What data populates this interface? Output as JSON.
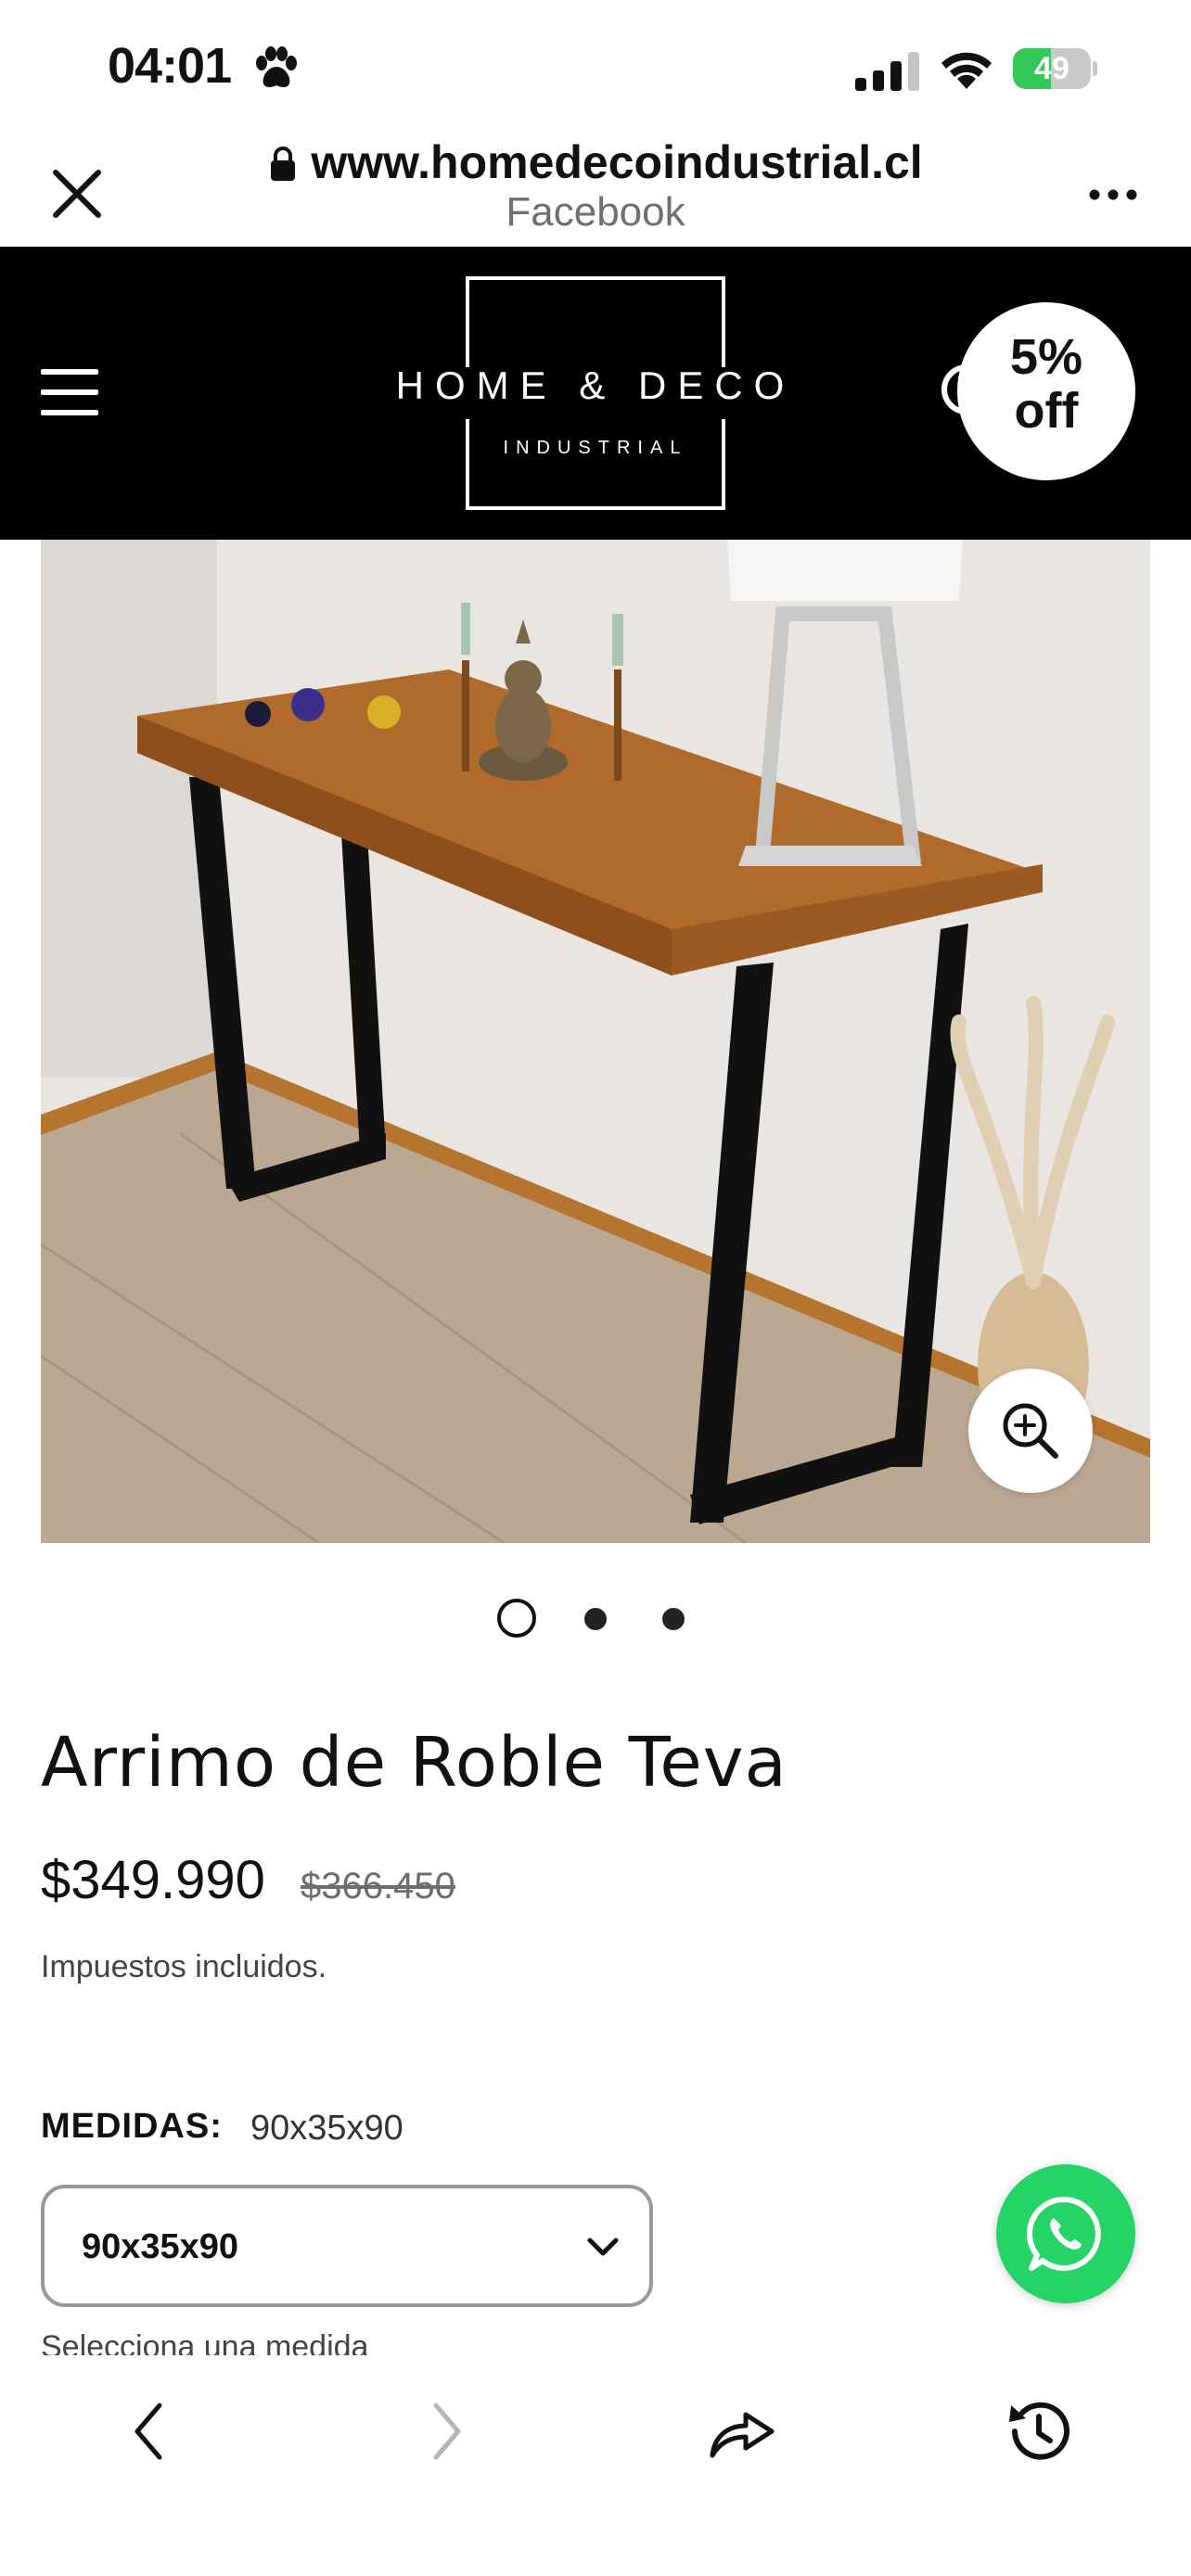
{
  "status_bar": {
    "time": "04:01",
    "battery_level": "49",
    "battery_fraction": 0.49
  },
  "browser": {
    "url": "www.homedecoindustrial.cl",
    "source": "Facebook"
  },
  "site_header": {
    "logo_main": "HOME & DECO",
    "logo_sub": "INDUSTRIAL",
    "badge_line1": "5%",
    "badge_line2": "off"
  },
  "carousel": {
    "total": 3,
    "active_index": 0
  },
  "product": {
    "title": "Arrimo de Roble Teva",
    "price": "$349.990",
    "compare_price": "$366.450",
    "tax_note": "Impuestos incluidos.",
    "variant_label": "MEDIDAS:",
    "variant_value": "90x35x90",
    "select_value": "90x35x90",
    "helper_text": "Selecciona una medida"
  },
  "colors": {
    "header_bg": "#000000",
    "whatsapp": "#25d366",
    "battery": "#34c759"
  },
  "icons": [
    "paw-icon",
    "signal-icon",
    "wifi-icon",
    "lock-icon",
    "close-icon",
    "more-icon",
    "menu-icon",
    "search-icon",
    "zoom-in-icon",
    "chevron-down-icon",
    "whatsapp-icon",
    "back-icon",
    "forward-icon",
    "share-icon",
    "history-icon"
  ]
}
